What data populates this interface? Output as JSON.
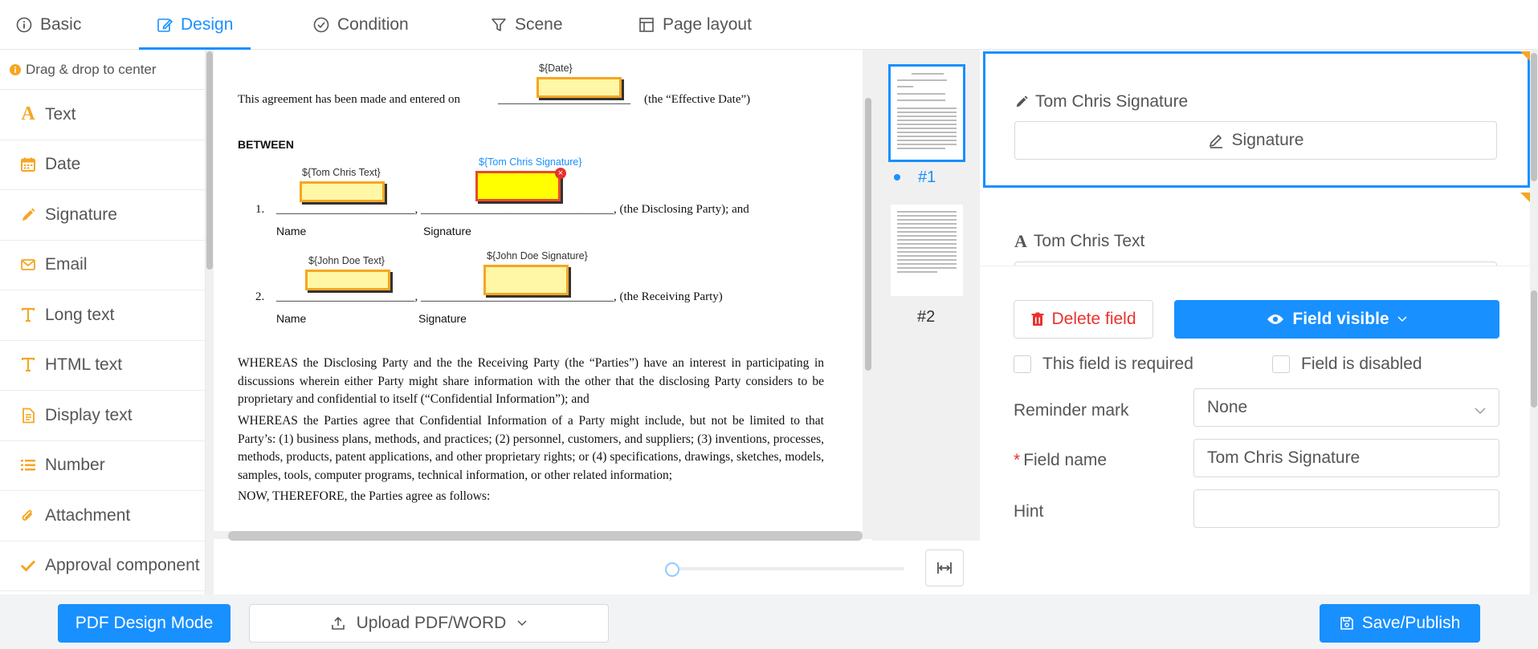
{
  "tabs": [
    {
      "label": "Basic"
    },
    {
      "label": "Design"
    },
    {
      "label": "Condition"
    },
    {
      "label": "Scene"
    },
    {
      "label": "Page layout"
    }
  ],
  "palette": {
    "hint": "Drag & drop to center",
    "items": [
      {
        "label": "Text",
        "icon": "text-icon"
      },
      {
        "label": "Date",
        "icon": "calendar-icon"
      },
      {
        "label": "Signature",
        "icon": "pen-icon"
      },
      {
        "label": "Email",
        "icon": "email-icon"
      },
      {
        "label": "Long text",
        "icon": "long-text-icon"
      },
      {
        "label": "HTML text",
        "icon": "html-text-icon"
      },
      {
        "label": "Display text",
        "icon": "document-icon"
      },
      {
        "label": "Number",
        "icon": "list-icon"
      },
      {
        "label": "Attachment",
        "icon": "paperclip-icon"
      },
      {
        "label": "Approval component",
        "icon": "check-icon"
      }
    ]
  },
  "document": {
    "line1_pre": "This agreement has been made and entered on",
    "line1_blank": "______________________",
    "line1_post": "(the “Effective Date”)",
    "between": "BETWEEN",
    "party1_num": "1.",
    "party1_line": "_______________________, ________________________________, (the Disclosing Party); and",
    "party2_num": "2.",
    "party2_line": "_______________________, ________________________________, (the Receiving Party)",
    "label_name": "Name",
    "label_signature": "Signature",
    "para1": "WHEREAS the Disclosing Party and the the Receiving Party (the “Parties”) have an interest in participating in discussions wherein either Party might share information with the other that the disclosing Party considers to be proprietary and confidential to itself (“Confidential Information”); and",
    "para2": "WHEREAS the Parties agree that Confidential Information of a Party might include, but not be limited to that Party’s: (1) business plans, methods, and practices; (2) personnel, customers, and suppliers; (3) inventions, processes, methods, products, patent applications, and other proprietary rights; or (4) specifications, drawings, sketches, models, samples, tools, computer programs, technical information, or other related information;",
    "para3": "NOW, THEREFORE, the Parties agree as follows:",
    "fields": [
      {
        "tag": "${Date}"
      },
      {
        "tag": "${Tom Chris Text}"
      },
      {
        "tag": "${Tom Chris Signature}"
      },
      {
        "tag": "${John Doe Text}"
      },
      {
        "tag": "${John Doe Signature}"
      }
    ],
    "close_glyph": "×"
  },
  "thumbnails": [
    {
      "label": "#1"
    },
    {
      "label": "#2"
    }
  ],
  "preview": {
    "card1_title": "Tom Chris Signature",
    "card1_button": "Signature",
    "card2_title": "Tom Chris Text"
  },
  "properties": {
    "delete_label": "Delete field",
    "visible_label": "Field visible",
    "required_label": "This field is required",
    "disabled_label": "Field is disabled",
    "reminder_label": "Reminder mark",
    "reminder_value": "None",
    "field_name_label": "Field name",
    "field_name_value": "Tom Chris Signature",
    "hint_label": "Hint",
    "hint_value": ""
  },
  "bottom": {
    "mode_label": "PDF Design Mode",
    "upload_label": "Upload PDF/WORD",
    "save_label": "Save/Publish"
  },
  "colors": {
    "accent": "#1890ff",
    "field_fill": "#fff7a6",
    "field_border": "#f5a623",
    "selected_field_fill": "#ffff00",
    "danger": "#e8322e"
  }
}
